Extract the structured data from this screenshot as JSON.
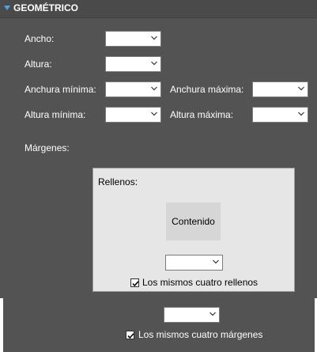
{
  "section": {
    "title": "GEOMÉTRICO",
    "accent_color": "#4ba3e8",
    "icon": "chevron-down-icon"
  },
  "fields": {
    "ancho": {
      "label": "Ancho:",
      "value": ""
    },
    "altura": {
      "label": "Altura:",
      "value": ""
    },
    "anchura_minima": {
      "label": "Anchura mínima:",
      "value": ""
    },
    "anchura_maxima": {
      "label": "Anchura máxima:",
      "value": ""
    },
    "altura_minima": {
      "label": "Altura mínima:",
      "value": ""
    },
    "altura_maxima": {
      "label": "Altura máxima:",
      "value": ""
    }
  },
  "margins": {
    "label": "Márgenes:",
    "value": "",
    "same_four": {
      "label": "Los mismos cuatro márgenes",
      "checked": true
    }
  },
  "padding": {
    "label": "Rellenos:",
    "content_label": "Contenido",
    "value": "",
    "same_four": {
      "label": "Los mismos cuatro rellenos",
      "checked": true
    }
  }
}
